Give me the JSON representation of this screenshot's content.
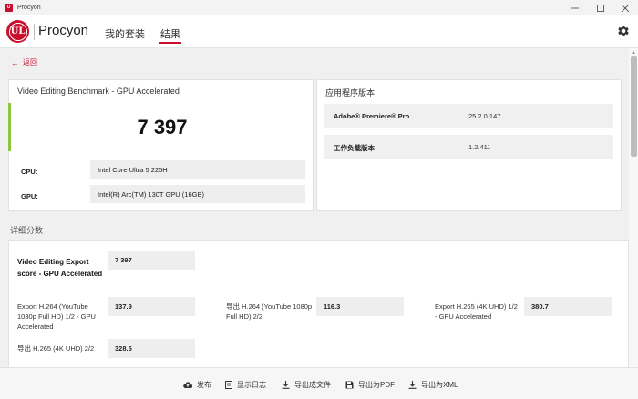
{
  "window": {
    "title": "Procyon"
  },
  "header": {
    "brand": "Procyon",
    "logo_text": "UL",
    "tabs": [
      {
        "label": "我的套装",
        "active": false
      },
      {
        "label": "结果",
        "active": true
      }
    ]
  },
  "back_label": "返回",
  "benchmark": {
    "title": "Video Editing Benchmark - GPU Accelerated",
    "score": "7 397",
    "specs": [
      {
        "label": "CPU:",
        "value": "Intel Core Ultra 5 225H"
      },
      {
        "label": "GPU:",
        "value": "Intel(R) Arc(TM) 130T GPU (16GB)"
      }
    ]
  },
  "versions": {
    "title": "应用程序版本",
    "rows": [
      {
        "name": "Adobe® Premiere® Pro",
        "value": "25.2.0.147"
      },
      {
        "name": "工作负载版本",
        "value": "1.2.411"
      }
    ]
  },
  "details": {
    "title": "详细分数",
    "main": {
      "label": "Video Editing Export score - GPU Accelerated",
      "value": "7 397"
    },
    "items": [
      {
        "label": "Export H.264 (YouTube 1080p Full HD) 1/2 - GPU Accelerated",
        "value": "137.9"
      },
      {
        "label": "导出 H.264 (YouTube 1080p Full HD) 2/2",
        "value": "116.3"
      },
      {
        "label": "Export H.265 (4K UHD) 1/2 - GPU Accelerated",
        "value": "380.7"
      },
      {
        "label": "导出 H.265 (4K UHD) 2/2",
        "value": "328.5"
      }
    ]
  },
  "footer": {
    "buttons": [
      {
        "label": "发布",
        "icon": "cloud-upload-icon"
      },
      {
        "label": "显示日志",
        "icon": "document-icon"
      },
      {
        "label": "导出成文件",
        "icon": "download-icon"
      },
      {
        "label": "导出为PDF",
        "icon": "save-icon"
      },
      {
        "label": "导出为XML",
        "icon": "download-icon"
      }
    ]
  },
  "colors": {
    "accent": "#c8102e",
    "score_bar": "#8dc63f"
  }
}
